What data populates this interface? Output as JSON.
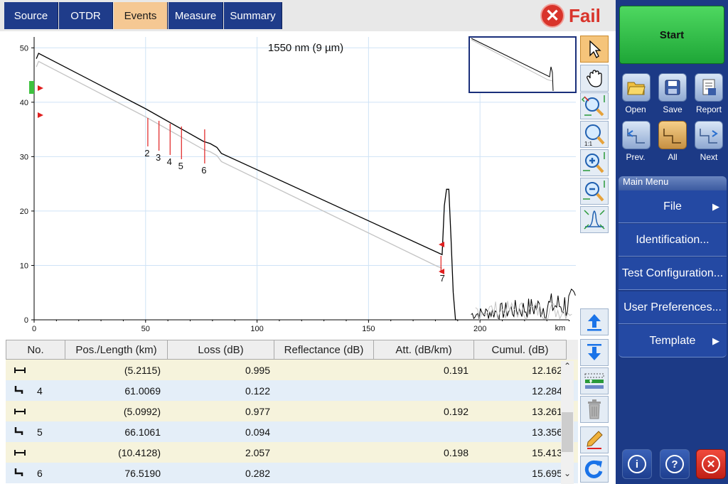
{
  "tabs": {
    "source": "Source",
    "otdr": "OTDR",
    "events": "Events",
    "measure": "Measure",
    "summary": "Summary"
  },
  "status": {
    "text": "Fail",
    "color": "#d9342b"
  },
  "chart_data": {
    "type": "line",
    "title": "1550 nm (9 µm)",
    "xlabel": "km",
    "ylabel": "",
    "xlim": [
      0,
      243
    ],
    "ylim": [
      0,
      52
    ],
    "xticks": [
      0,
      50,
      100,
      150,
      200
    ],
    "yticks": [
      0,
      10,
      20,
      30,
      40,
      50
    ],
    "grid": true,
    "series": [
      {
        "color": "#000000",
        "x": [
          1,
          2,
          50,
          76,
          79,
          82,
          84,
          183,
          184,
          185,
          186,
          187,
          188,
          189,
          190
        ],
        "y": [
          48,
          49,
          38.8,
          32.8,
          32.4,
          31.7,
          30.6,
          12,
          21,
          24,
          24,
          15,
          5,
          0,
          0
        ]
      },
      {
        "color": "#c4c4c4",
        "x": [
          1,
          2,
          50,
          76,
          79,
          82,
          84,
          181,
          183
        ],
        "y": [
          46.5,
          47.5,
          37.3,
          31.3,
          30.9,
          30.2,
          29.1,
          9.8,
          9.5
        ]
      }
    ],
    "markers": [
      {
        "label": "2",
        "x": 51.0
      },
      {
        "label": "3",
        "x": 56.0
      },
      {
        "label": "4",
        "x": 61.0
      },
      {
        "label": "5",
        "x": 66.1
      },
      {
        "label": "6",
        "x": 76.5
      },
      {
        "label": "7",
        "x": 182.5
      }
    ]
  },
  "table": {
    "headers": [
      "No.",
      "Pos./Length (km)",
      "Loss (dB)",
      "Reflectance (dB)",
      "Att. (dB/km)",
      "Cumul. (dB)"
    ],
    "rows": [
      {
        "kind": "span",
        "no": "",
        "pos": "(5.2115)",
        "loss": "0.995",
        "refl": "",
        "att": "0.191",
        "cum": "12.162"
      },
      {
        "kind": "event",
        "no": "4",
        "pos": "61.0069",
        "loss": "0.122",
        "refl": "",
        "att": "",
        "cum": "12.284"
      },
      {
        "kind": "span",
        "no": "",
        "pos": "(5.0992)",
        "loss": "0.977",
        "refl": "",
        "att": "0.192",
        "cum": "13.261"
      },
      {
        "kind": "event",
        "no": "5",
        "pos": "66.1061",
        "loss": "0.094",
        "refl": "",
        "att": "",
        "cum": "13.356"
      },
      {
        "kind": "span",
        "no": "",
        "pos": "(10.4128)",
        "loss": "2.057",
        "refl": "",
        "att": "0.198",
        "cum": "15.413"
      },
      {
        "kind": "event",
        "no": "6",
        "pos": "76.5190",
        "loss": "0.282",
        "refl": "",
        "att": "",
        "cum": "15.695"
      }
    ]
  },
  "right_panel": {
    "start": "Start",
    "open": "Open",
    "save": "Save",
    "report": "Report",
    "prev": "Prev.",
    "all": "All",
    "next": "Next",
    "menu_header": "Main Menu",
    "file": "File",
    "identification": "Identification...",
    "test_configuration": "Test Configuration...",
    "user_preferences": "User Preferences...",
    "template": "Template"
  },
  "icons": {
    "fail": "close-icon",
    "pointer": "pointer-icon",
    "pan": "hand-icon",
    "info": "info-icon",
    "help": "help-icon",
    "exit": "close-icon"
  }
}
